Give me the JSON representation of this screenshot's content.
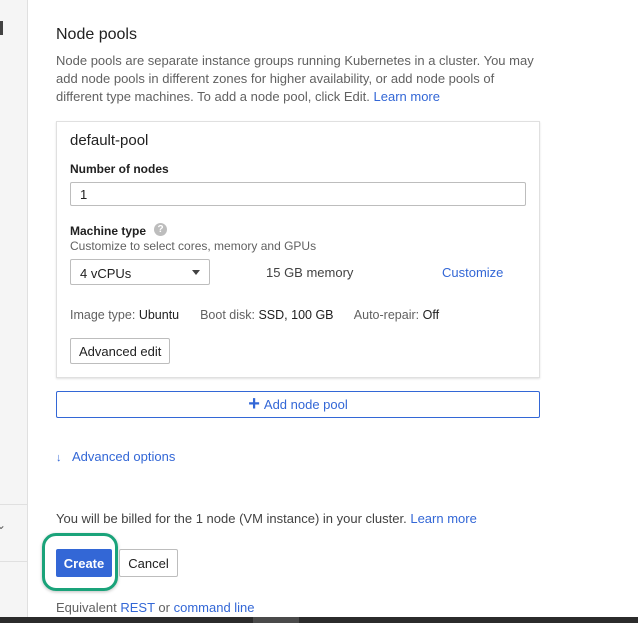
{
  "node_pools": {
    "title": "Node pools",
    "description": "Node pools are separate instance groups running Kubernetes in a cluster. You may add node pools in different zones for higher availability, or add node pools of different type machines. To add a node pool, click Edit.",
    "learn_more": "Learn more"
  },
  "pool": {
    "name": "default-pool",
    "nodes_label": "Number of nodes",
    "nodes_value": "1",
    "machine_type_label": "Machine type",
    "help_icon_glyph": "?",
    "machine_type_sub": "Customize to select cores, memory and GPUs",
    "vcpu_selected": "4 vCPUs",
    "memory": "15 GB memory",
    "customize": "Customize",
    "image_type_label": "Image type:",
    "image_type_value": "Ubuntu",
    "boot_disk_label": "Boot disk:",
    "boot_disk_value": "SSD, 100 GB",
    "auto_repair_label": "Auto-repair:",
    "auto_repair_value": "Off",
    "advanced_edit": "Advanced edit"
  },
  "add_node_pool": "Add node pool",
  "advanced_options": "Advanced options",
  "billing": {
    "text": "You will be billed for the 1 node (VM instance) in your cluster.",
    "learn_more": "Learn more"
  },
  "actions": {
    "create": "Create",
    "cancel": "Cancel"
  },
  "equivalent": {
    "prefix": "Equivalent",
    "rest": "REST",
    "or": "or",
    "command_line": "command line"
  },
  "icons": {
    "help": "help-circle-icon",
    "add": "plus-icon",
    "expand": "double-chevron-down-icon",
    "dropdown": "caret-down-icon"
  },
  "colors": {
    "accent": "#3367d6",
    "highlight": "#1aa37a"
  }
}
